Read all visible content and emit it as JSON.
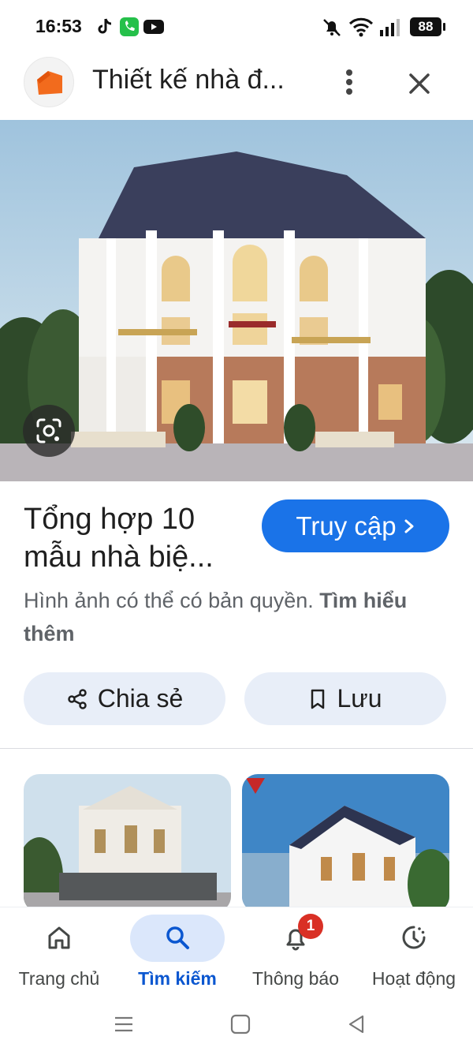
{
  "status_bar": {
    "time": "16:53",
    "battery": "88",
    "left_icons": [
      "tiktok-icon",
      "phone-icon",
      "youtube-icon"
    ],
    "right_icons": [
      "bell-muted-icon",
      "wifi-icon",
      "signal-icon",
      "battery-icon"
    ]
  },
  "header": {
    "title": "Thiết kế nhà đ...",
    "logo": "site-logo-house-icon",
    "more_icon": "more-vert-icon",
    "close_icon": "close-icon"
  },
  "result": {
    "title": "Tổng hợp 10 mẫu nhà biệ...",
    "visit_label": "Truy cập",
    "copyright_text": "Hình ảnh có thể có bản quyền.",
    "learn_more": "Tìm hiểu thêm"
  },
  "actions": {
    "share_label": "Chia sẻ",
    "save_label": "Lưu"
  },
  "bottom_nav": {
    "items": [
      {
        "label": "Trang chủ",
        "icon": "home-icon",
        "active": false
      },
      {
        "label": "Tìm kiếm",
        "icon": "search-icon",
        "active": true
      },
      {
        "label": "Thông báo",
        "icon": "bell-icon",
        "active": false,
        "badge": "1"
      },
      {
        "label": "Hoạt động",
        "icon": "history-icon",
        "active": false
      }
    ]
  },
  "colors": {
    "accent": "#1a73e8",
    "active_nav": "#0b57d0",
    "pill_bg": "#e8eef8",
    "badge": "#d93025"
  }
}
